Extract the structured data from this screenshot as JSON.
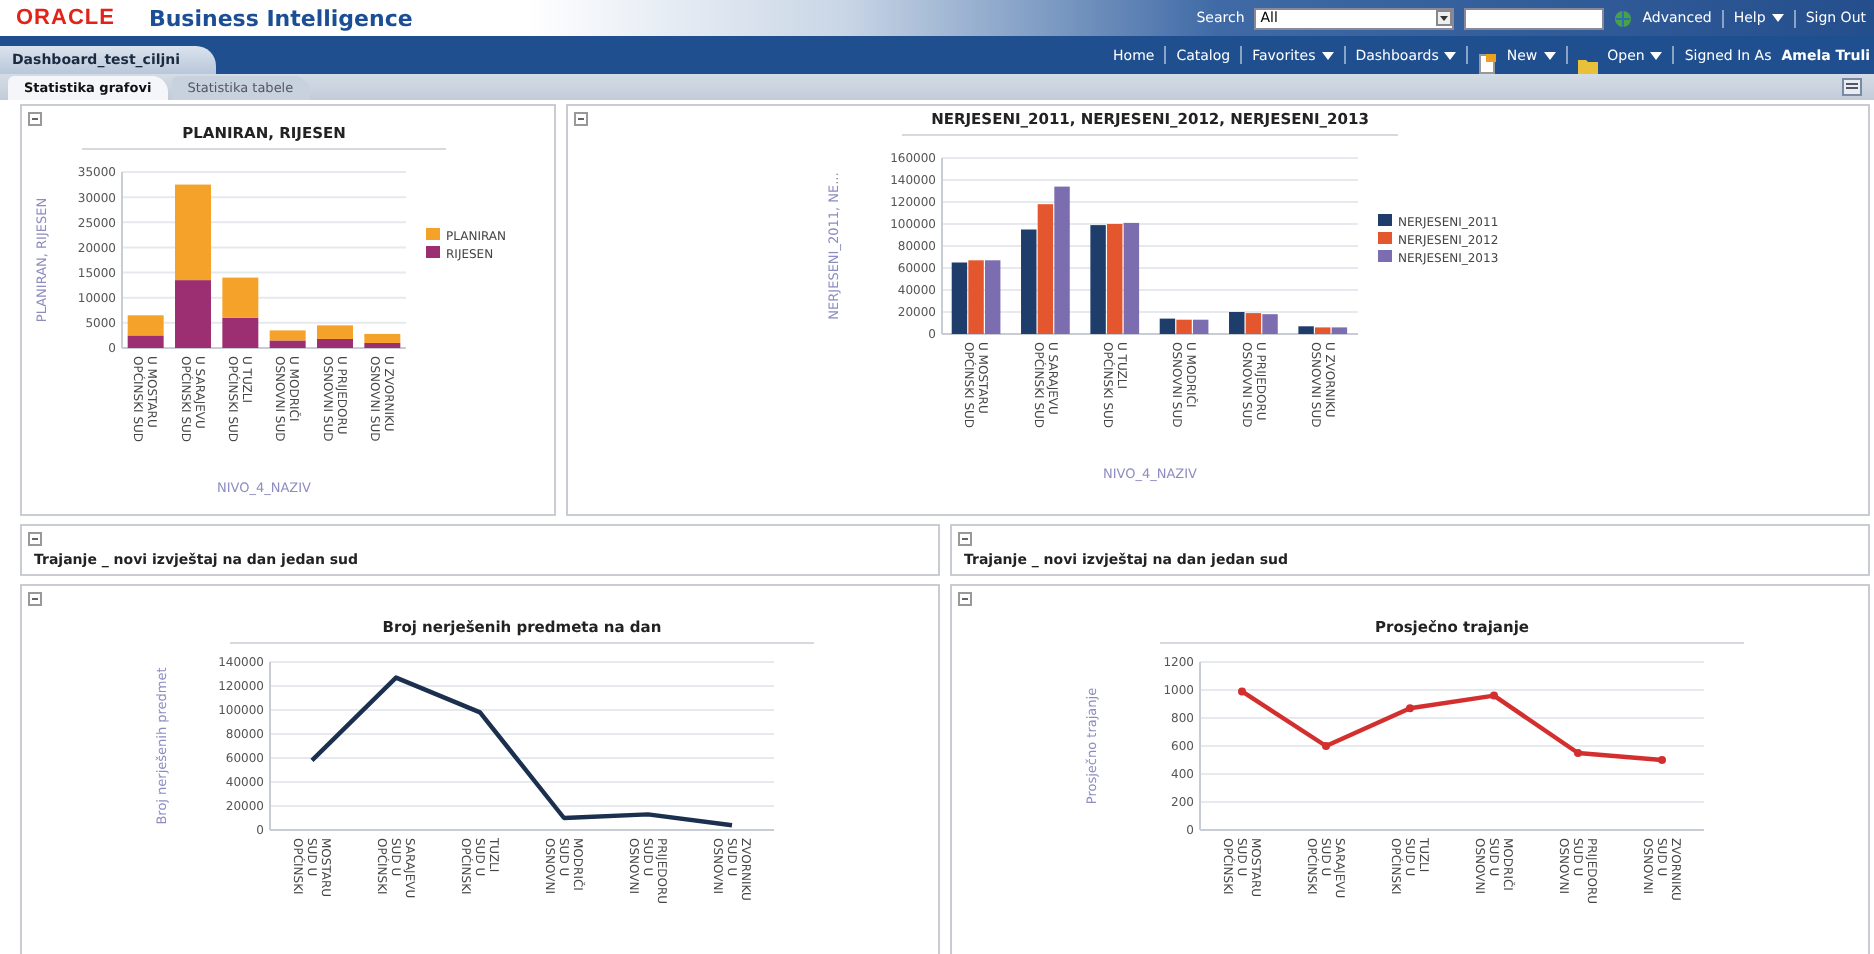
{
  "header": {
    "logo": "ORACLE",
    "product": "Business Intelligence",
    "search_label": "Search",
    "search_scope": "All",
    "global_links": [
      {
        "label": "Advanced",
        "menu": false
      },
      {
        "label": "Help",
        "menu": true
      },
      {
        "label": "Sign Out",
        "menu": false
      }
    ],
    "dashboard_tab": "Dashboard_test_ciljni",
    "nav_links": [
      {
        "label": "Home",
        "menu": false
      },
      {
        "label": "Catalog",
        "menu": false
      },
      {
        "label": "Favorites",
        "menu": true
      },
      {
        "label": "Dashboards",
        "menu": true
      },
      {
        "label": "New",
        "menu": true
      },
      {
        "label": "Open",
        "menu": true
      }
    ],
    "signed_in_label": "Signed In As",
    "user": "Amela Truli"
  },
  "page_tabs": [
    {
      "label": "Statistika grafovi",
      "selected": true
    },
    {
      "label": "Statistika tabele",
      "selected": false
    }
  ],
  "top_panels": [
    {
      "chart_data": {
        "type": "bar",
        "stacked": true,
        "grid": true,
        "legend": "right",
        "title": "PLANIRAN, RIJESEN",
        "xlabel": "NIVO_4_NAZIV",
        "ylabel": "PLANIRAN, RIJESEN",
        "categories": [
          "OPĆINSKI SUD U MOSTARU",
          "OPĆINSKI SUD U SARAJEVU",
          "OPĆINSKI SUD U TUZLI",
          "OSNOVNI SUD U MODRIČI",
          "OSNOVNI SUD U PRIJEDORU",
          "OSNOVNI SUD U ZVORNIKU"
        ],
        "ylim": [
          0,
          35000
        ],
        "yticks": [
          0,
          5000,
          10000,
          15000,
          20000,
          25000,
          30000,
          35000
        ],
        "series": [
          {
            "name": "PLANIRAN",
            "color": "#f4a22a",
            "values": [
              4000,
              19000,
              8000,
              2000,
              2700,
              1800
            ]
          },
          {
            "name": "RIJESEN",
            "color": "#9c2f72",
            "values": [
              2500,
              13500,
              6000,
              1500,
              1800,
              1000
            ]
          }
        ]
      }
    },
    {
      "chart_data": {
        "type": "bar",
        "stacked": false,
        "grid": true,
        "legend": "right",
        "title": "NERJESENI_2011, NERJESENI_2012, NERJESENI_2013",
        "xlabel": "NIVO_4_NAZIV",
        "ylabel": "NERJESENI_2011, NE...",
        "categories": [
          "OPĆINSKI SUD U MOSTARU",
          "OPĆINSKI SUD U SARAJEVU",
          "OPĆINSKI SUD U TUZLI",
          "OSNOVNI SUD U MODRIČI",
          "OSNOVNI SUD U PRIJEDORU",
          "OSNOVNI SUD U ZVORNIKU"
        ],
        "ylim": [
          0,
          160000
        ],
        "yticks": [
          0,
          20000,
          40000,
          60000,
          80000,
          100000,
          120000,
          140000,
          160000
        ],
        "series": [
          {
            "name": "NERJESENI_2011",
            "color": "#1f3d6b",
            "values": [
              65000,
              95000,
              99000,
              14000,
              20000,
              7000
            ]
          },
          {
            "name": "NERJESENI_2012",
            "color": "#e4572e",
            "values": [
              67000,
              118000,
              100000,
              13000,
              19000,
              6000
            ]
          },
          {
            "name": "NERJESENI_2013",
            "color": "#7b6db0",
            "values": [
              67000,
              134000,
              101000,
              13000,
              18000,
              6000
            ]
          }
        ]
      }
    }
  ],
  "section_bars": [
    {
      "title": "Trajanje _ novi izvještaj na dan jedan sud"
    },
    {
      "title": "Trajanje _ novi izvještaj na dan jedan sud"
    }
  ],
  "bottom_panels": [
    {
      "chart_data": {
        "type": "line",
        "grid": true,
        "title": "Broj nerješenih predmeta na dan",
        "ylabel": "Broj nerješenih predmet",
        "categories": [
          "OPĆINSKI SUD U MOSTARU",
          "OPĆINSKI SUD U SARAJEVU",
          "OPĆINSKI SUD U TUZLI",
          "OSNOVNI SUD U MODRIČI",
          "OSNOVNI SUD U PRIJEDORU",
          "OSNOVNI SUD U ZVORNIKU"
        ],
        "ylim": [
          0,
          140000
        ],
        "yticks": [
          0,
          20000,
          40000,
          60000,
          80000,
          100000,
          120000,
          140000
        ],
        "series": [
          {
            "color": "#1b2f4f",
            "marker": false,
            "values": [
              58000,
              127000,
              98000,
              10000,
              13000,
              4000
            ]
          }
        ]
      }
    },
    {
      "chart_data": {
        "type": "line",
        "grid": true,
        "title": "Prosječno trajanje",
        "ylabel": "Prosječno trajanje",
        "categories": [
          "OPĆINSKI SUD U MOSTARU",
          "OPĆINSKI SUD U SARAJEVU",
          "OPĆINSKI SUD U TUZLI",
          "OSNOVNI SUD U MODRIČI",
          "OSNOVNI SUD U PRIJEDORU",
          "OSNOVNI SUD U ZVORNIKU"
        ],
        "ylim": [
          0,
          1200
        ],
        "yticks": [
          0,
          200,
          400,
          600,
          800,
          1000,
          1200
        ],
        "series": [
          {
            "color": "#d42f2f",
            "marker": true,
            "values": [
              990,
              600,
              870,
              960,
              550,
              500
            ]
          }
        ]
      }
    }
  ]
}
